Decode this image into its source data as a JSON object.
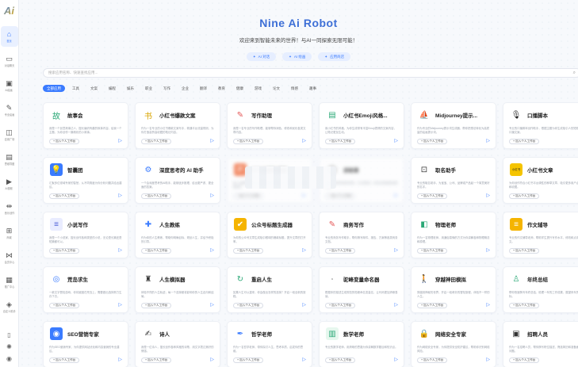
{
  "app": {
    "logo": "Ai",
    "title": "Nine Ai Robot",
    "subtitle": "欢迎来到智能未来的世界！与AI一同探索无限可能！"
  },
  "hero_buttons": [
    {
      "label": "AI 对话",
      "icon": "chat-icon"
    },
    {
      "label": "AI 绘画",
      "icon": "brush-icon"
    },
    {
      "label": "应用商店",
      "icon": "store-icon"
    }
  ],
  "sidebar": {
    "items": [
      {
        "label": "首页",
        "icon": "home-icon",
        "glyph": "⌂"
      },
      {
        "label": "对话聊天",
        "icon": "chat-icon",
        "glyph": "▭"
      },
      {
        "label": "AI绘画",
        "icon": "image-icon",
        "glyph": "▣"
      },
      {
        "label": "专业绘画",
        "icon": "palette-icon",
        "glyph": "✎"
      },
      {
        "label": "应用广场",
        "icon": "apps-icon",
        "glyph": "◫"
      },
      {
        "label": "思维导图",
        "icon": "note-icon",
        "glyph": "▤"
      },
      {
        "label": "AI视频",
        "icon": "video-icon",
        "glyph": "▶"
      },
      {
        "label": "音乐创作",
        "icon": "music-icon",
        "glyph": "⇹"
      },
      {
        "label": "商城",
        "icon": "cart-icon",
        "glyph": "⊞"
      },
      {
        "label": "会员中心",
        "icon": "share-icon",
        "glyph": "⋈"
      },
      {
        "label": "推广中心",
        "icon": "gift-icon",
        "glyph": "▦"
      },
      {
        "label": "自定义助手",
        "icon": "bot-icon",
        "glyph": "◈"
      }
    ],
    "bottom": [
      {
        "icon": "phone-icon",
        "glyph": "▯"
      },
      {
        "icon": "settings-icon",
        "glyph": "✺"
      },
      {
        "icon": "user-icon",
        "glyph": "◉"
      }
    ]
  },
  "search": {
    "placeholder": "搜索应用名称、快速查找应用..."
  },
  "tabs": [
    "全部应用",
    "工具",
    "文案",
    "编程",
    "娱乐",
    "职业",
    "写作",
    "企业",
    "翻译",
    "教育",
    "健康",
    "游戏",
    "论文",
    "情感",
    "趣事"
  ],
  "cards": [
    {
      "title": "故事会",
      "icon": "story-icon",
      "glyph": "故",
      "color": "#ffffff",
      "fg": "#2aa876",
      "desc": "我是一个创意故事达人，擅长编织有趣的故事内容。给我一个主题，为你创作一篇精彩的小故事。",
      "add": "+ 加入个人工作台"
    },
    {
      "title": "小红书爆款文案",
      "icon": "book-icon",
      "glyph": "书",
      "color": "#ffffff",
      "fg": "#d9a400",
      "desc": "作为一名专业的小红书爆款文案写手，精通平台流量规则，为你打造高赞高收藏的笔记内容。",
      "add": "+ 加入个人工作台"
    },
    {
      "title": "写作助理",
      "icon": "pen-icon",
      "glyph": "✎",
      "color": "#ffffff",
      "fg": "#e45656",
      "desc": "我是一名专业的写作助理，能够帮你润色、修改和优化各类文章内容。",
      "add": "+ 加入个人工作台"
    },
    {
      "title": "小红书Emoji风格...",
      "icon": "doc-icon",
      "glyph": "▤",
      "color": "#ffffff",
      "fg": "#2aa876",
      "desc": "用小红书的风格，为你生成带有丰富Emoji表情的文案内容，让笔记更加生动。",
      "add": "+ 加入个人工作台"
    },
    {
      "title": "Midjourney提示...",
      "icon": "boat-icon",
      "glyph": "⛵",
      "color": "#ffffff",
      "fg": "#333333",
      "desc": "作为专业的Midjourney提示词生成器，帮你把想法转化为高质量的绘画提示词。",
      "add": "+ 加入个人工作台"
    },
    {
      "title": "口播脚本",
      "icon": "mic-icon",
      "glyph": "🎙",
      "color": "#ffffff",
      "fg": "#222222",
      "desc": "专业的口播脚本创作助手，根据主题为你生成吸引人的短视频口播文案。",
      "add": "+ 加入个人工作台"
    },
    {
      "title": "智囊团",
      "icon": "bulb-icon",
      "glyph": "💡",
      "color": "#3a7bff",
      "fg": "#ffffff",
      "desc": "汇聚多位领域专家的智慧，从不同角度为你分析问题并给出建议。",
      "add": "+ 加入个人工作台"
    },
    {
      "title": "深度思考的 AI 助手",
      "icon": "robot-icon",
      "glyph": "⚙",
      "color": "#ffffff",
      "fg": "#3a7bff",
      "desc": "一个会深度思考的AI助手，能够逐步推理，给出更严谨、更全面的答案。",
      "add": "+ 加入个人工作台"
    },
    {
      "title": "PPT大纲生成器",
      "icon": "ppt-icon",
      "glyph": "P",
      "color": "#f26b3a",
      "fg": "#ffffff",
      "desc": "输入主题即可快速生成结构清晰的PPT大纲，提升你的演示准备效率。",
      "add": "+ 加入个人工作台"
    },
    {
      "title": "讲故事",
      "icon": "search-book-icon",
      "glyph": "◯",
      "color": "#ffffff",
      "fg": "#333333",
      "desc": "我擅长讲各种类型的故事，无论是童话、寓言还是悬疑故事都可以。",
      "add": "+ 加入个人工作台"
    },
    {
      "title": "取名助手",
      "icon": "tag-icon",
      "glyph": "⊡",
      "color": "#ffffff",
      "fg": "#333333",
      "desc": "专业的取名助手，为宝宝、公司、品牌或产品起一个寓意美好的名字。",
      "add": "+ 加入个人工作台"
    },
    {
      "title": "小红书文章",
      "icon": "xhs-icon",
      "glyph": "小红书",
      "color": "#f5c400",
      "fg": "#222222",
      "desc": "为你创作符合小红书平台调性的种草文章，吸引更多用户点赞和收藏。",
      "add": "+ 加入个人工作台"
    },
    {
      "title": "小说写作",
      "icon": "novel-icon",
      "glyph": "≡",
      "color": "#e9ecff",
      "fg": "#4a5bd6",
      "desc": "我是一个小说家，擅长创作各种类型的小说，无论是长篇还是短篇都可以。",
      "add": "+ 加入个人工作台"
    },
    {
      "title": "人生教练",
      "icon": "coach-icon",
      "glyph": "✚",
      "color": "#ffffff",
      "fg": "#3a7bff",
      "desc": "作为你的人生教练，帮助你明确目标、规划人生，并给予积极的引导。",
      "add": "+ 加入个人工作台"
    },
    {
      "title": "公众号标题生成器",
      "icon": "badge-icon",
      "glyph": "✔",
      "color": "#f5b400",
      "fg": "#ffffff",
      "desc": "为你的公众号文章生成吸引眼球的爆款标题，提升文章的打开率。",
      "add": "+ 加入个人工作台"
    },
    {
      "title": "商务写作",
      "icon": "biz-icon",
      "glyph": "✎",
      "color": "#ffffff",
      "fg": "#e45656",
      "desc": "专业的商务写作助手，帮你撰写邮件、报告、方案等各类商务文档。",
      "add": "+ 加入个人工作台"
    },
    {
      "title": "物理老师",
      "icon": "cube-icon",
      "glyph": "◧",
      "color": "#ffffff",
      "fg": "#2aa876",
      "desc": "作为一名物理老师，用通俗易懂的方式为你讲解各种物理概念和原理。",
      "add": "+ 加入个人工作台"
    },
    {
      "title": "作文辅导",
      "icon": "essay-icon",
      "glyph": "≡",
      "color": "#f5b400",
      "fg": "#ffffff",
      "desc": "专业的作文辅导老师，帮助学生提升写作水平，修改和点评作文。",
      "add": "+ 加入个人工作台"
    },
    {
      "title": "荒岛求生",
      "icon": "lifebuoy-icon",
      "glyph": "◎",
      "color": "#ffffff",
      "fg": "#3a7bff",
      "desc": "一款文字冒险游戏，你将被困在荒岛上，需要做出选择努力生存下去。",
      "add": "+ 加入个人工作台"
    },
    {
      "title": "人生模拟器",
      "icon": "tower-icon",
      "glyph": "♜",
      "color": "#ffffff",
      "fg": "#333333",
      "desc": "体验不同的人生轨迹，每一个选择都将影响你的人生走向和结局。",
      "add": "+ 加入个人工作台"
    },
    {
      "title": "重启人生",
      "icon": "restart-icon",
      "glyph": "↻",
      "color": "#ffffff",
      "fg": "#2aa876",
      "desc": "如果人生可以重来，你会做出怎样的选择？开启一段全新的旅程。",
      "add": "+ 加入个人工作台"
    },
    {
      "title": "驼峰变量命名器",
      "icon": "variable-icon",
      "glyph": "𝑥",
      "color": "#ffffff",
      "fg": "#333333",
      "desc": "根据你的描述生成规范的驼峰命名变量名，让代码更加清晰易读。",
      "add": "+ 加入个人工作台"
    },
    {
      "title": "穿越神田模拟",
      "icon": "walk-icon",
      "glyph": "🚶",
      "color": "#ffffff",
      "fg": "#2aa876",
      "desc": "穿越到神秘的世界，开启一段奇妙的冒险旅程，体验不一样的人生。",
      "add": "+ 加入个人工作台"
    },
    {
      "title": "年终总结",
      "icon": "person-icon",
      "glyph": "♙",
      "color": "#ffffff",
      "fg": "#2aa876",
      "desc": "帮你快速撰写年终总结，梳理一年的工作成果，展望来年的目标。",
      "add": "+ 加入个人工作台"
    },
    {
      "title": "SEO营销专家",
      "icon": "seo-icon",
      "glyph": "◉",
      "color": "#3a7bff",
      "fg": "#ffffff",
      "desc": "作为SEO营销专家，为你提供网站优化和内容营销的专业建议。",
      "add": "+ 加入个人工作台"
    },
    {
      "title": "诗人",
      "icon": "poet-icon",
      "glyph": "✍",
      "color": "#ffffff",
      "fg": "#333333",
      "desc": "我是一位诗人，擅长创作各种风格的诗歌，用文字表达美好的情感。",
      "add": "+ 加入个人工作台"
    },
    {
      "title": "哲学老师",
      "icon": "quill-icon",
      "glyph": "✒",
      "color": "#ffffff",
      "fg": "#3a7bff",
      "desc": "作为一名哲学老师，带你探讨人生、思考本质，启发你的思维。",
      "add": "+ 加入个人工作台"
    },
    {
      "title": "数学老师",
      "icon": "math-icon",
      "glyph": "▥",
      "color": "#e6f7ee",
      "fg": "#2aa876",
      "desc": "专业的数学老师，用清晰的思路为你讲解数学题目和知识点。",
      "add": "+ 加入个人工作台"
    },
    {
      "title": "网络安全专家",
      "icon": "lock-icon",
      "glyph": "🔒",
      "color": "#ffffff",
      "fg": "#f5a000",
      "desc": "作为网络安全专家，为你提供安全防护建议，帮助你识别网络风险。",
      "add": "+ 加入个人工作台"
    },
    {
      "title": "招聘人员",
      "icon": "recruit-icon",
      "glyph": "▣",
      "color": "#ffffff",
      "fg": "#333333",
      "desc": "作为一名招聘人员，帮你撰写职位描述、筛选简历和准备面试问题。",
      "add": "+ 加入个人工作台"
    }
  ],
  "colors": {
    "accent": "#3a7bff",
    "title": "#3d6fd6"
  }
}
